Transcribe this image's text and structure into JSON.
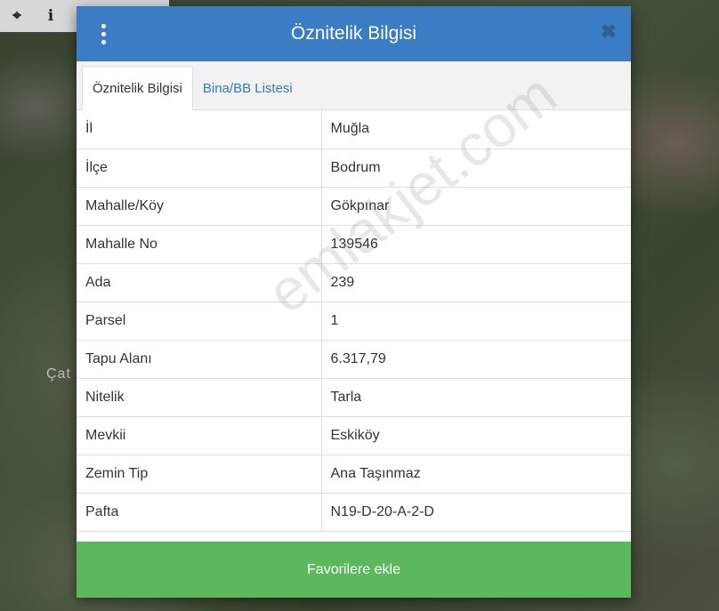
{
  "toolbar": {
    "items": [
      {
        "icon": "crosshair-icon",
        "glyph": "⌖"
      },
      {
        "icon": "info-icon",
        "glyph": "i"
      }
    ]
  },
  "map": {
    "place_label": "Çat"
  },
  "modal": {
    "title": "Öznitelik Bilgisi",
    "tabs": [
      {
        "label": "Öznitelik Bilgisi",
        "active": true
      },
      {
        "label": "Bina/BB Listesi",
        "active": false
      }
    ],
    "rows": [
      {
        "key": "İl",
        "value": "Muğla"
      },
      {
        "key": "İlçe",
        "value": "Bodrum"
      },
      {
        "key": "Mahalle/Köy",
        "value": "Gökpınar"
      },
      {
        "key": "Mahalle No",
        "value": "139546"
      },
      {
        "key": "Ada",
        "value": "239"
      },
      {
        "key": "Parsel",
        "value": "1"
      },
      {
        "key": "Tapu Alanı",
        "value": "6.317,79"
      },
      {
        "key": "Nitelik",
        "value": "Tarla"
      },
      {
        "key": "Mevkii",
        "value": "Eskiköy"
      },
      {
        "key": "Zemin Tip",
        "value": "Ana Taşınmaz"
      },
      {
        "key": "Pafta",
        "value": "N19-D-20-A-2-D"
      }
    ],
    "favorite_label": "Favorilere ekle",
    "close_glyph": "✖"
  },
  "watermark": "emlakjet.com",
  "colors": {
    "header": "#3a7dc4",
    "favorite": "#5cb85c",
    "tab_link": "#337ab7"
  }
}
